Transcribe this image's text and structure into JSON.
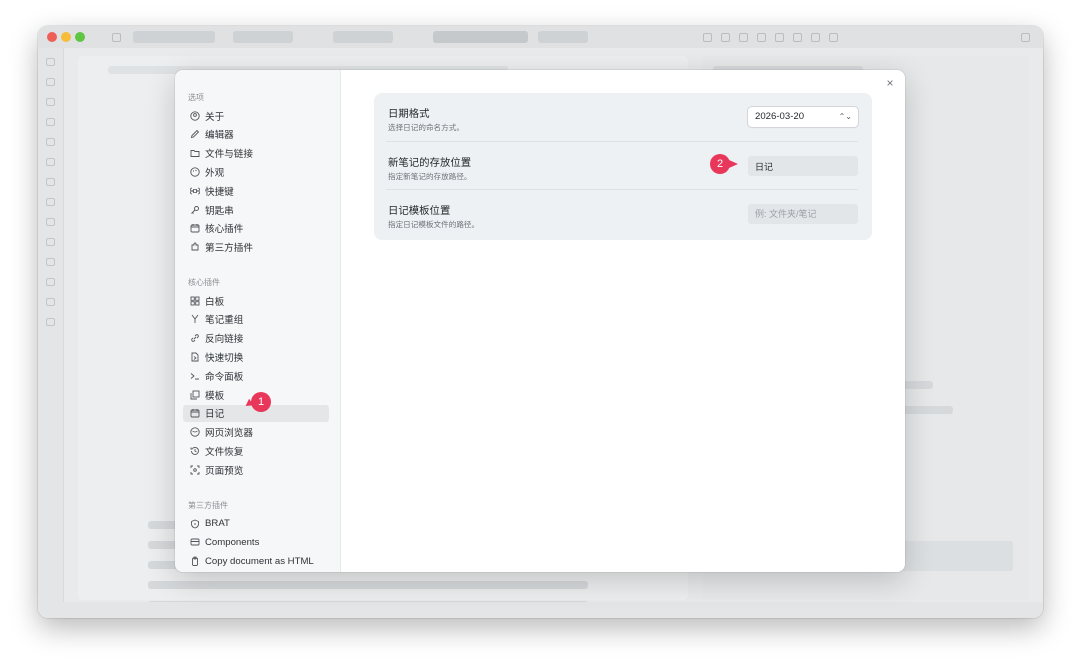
{
  "settings": {
    "sections": {
      "options": "选项",
      "core_plugins": "核心插件",
      "third_party": "第三方插件"
    },
    "options_items": [
      {
        "label": "关于",
        "icon": "user-circle-icon"
      },
      {
        "label": "编辑器",
        "icon": "pencil-icon"
      },
      {
        "label": "文件与链接",
        "icon": "folder-link-icon"
      },
      {
        "label": "外观",
        "icon": "palette-icon"
      },
      {
        "label": "快捷键",
        "icon": "command-icon"
      },
      {
        "label": "钥匙串",
        "icon": "key-icon"
      },
      {
        "label": "核心插件",
        "icon": "plug-icon"
      },
      {
        "label": "第三方插件",
        "icon": "puzzle-icon"
      }
    ],
    "core_items": [
      {
        "label": "白板",
        "icon": "canvas-icon"
      },
      {
        "label": "笔记重组",
        "icon": "merge-icon"
      },
      {
        "label": "反向链接",
        "icon": "backlink-icon"
      },
      {
        "label": "快速切换",
        "icon": "quick-switch-icon"
      },
      {
        "label": "命令面板",
        "icon": "terminal-icon"
      },
      {
        "label": "模板",
        "icon": "template-icon"
      },
      {
        "label": "日记",
        "icon": "calendar-icon",
        "active": true
      },
      {
        "label": "网页浏览器",
        "icon": "globe-icon"
      },
      {
        "label": "文件恢复",
        "icon": "history-icon"
      },
      {
        "label": "页面预览",
        "icon": "preview-icon"
      }
    ],
    "third_party_items": [
      {
        "label": "BRAT",
        "icon": "shield-icon"
      },
      {
        "label": "Components",
        "icon": "components-icon"
      },
      {
        "label": "Copy document as HTML",
        "icon": "clipboard-icon"
      }
    ],
    "daily_notes": {
      "date_format": {
        "title": "日期格式",
        "desc": "选择日记的命名方式。",
        "value": "2026-03-20"
      },
      "new_file_location": {
        "title": "新笔记的存放位置",
        "desc": "指定新笔记的存放路径。",
        "value": "日记"
      },
      "template_location": {
        "title": "日记模板位置",
        "desc": "指定日记模板文件的路径。",
        "placeholder": "例: 文件夹/笔记"
      }
    },
    "close_symbol": "×"
  },
  "annotations": {
    "badge_1": "1",
    "badge_2": "2",
    "badge_color": "#e8375a"
  },
  "colors": {
    "accent_badge": "#e8375a",
    "card_bg": "#eef1f3",
    "sidebar_bg": "#f6f7f8"
  }
}
